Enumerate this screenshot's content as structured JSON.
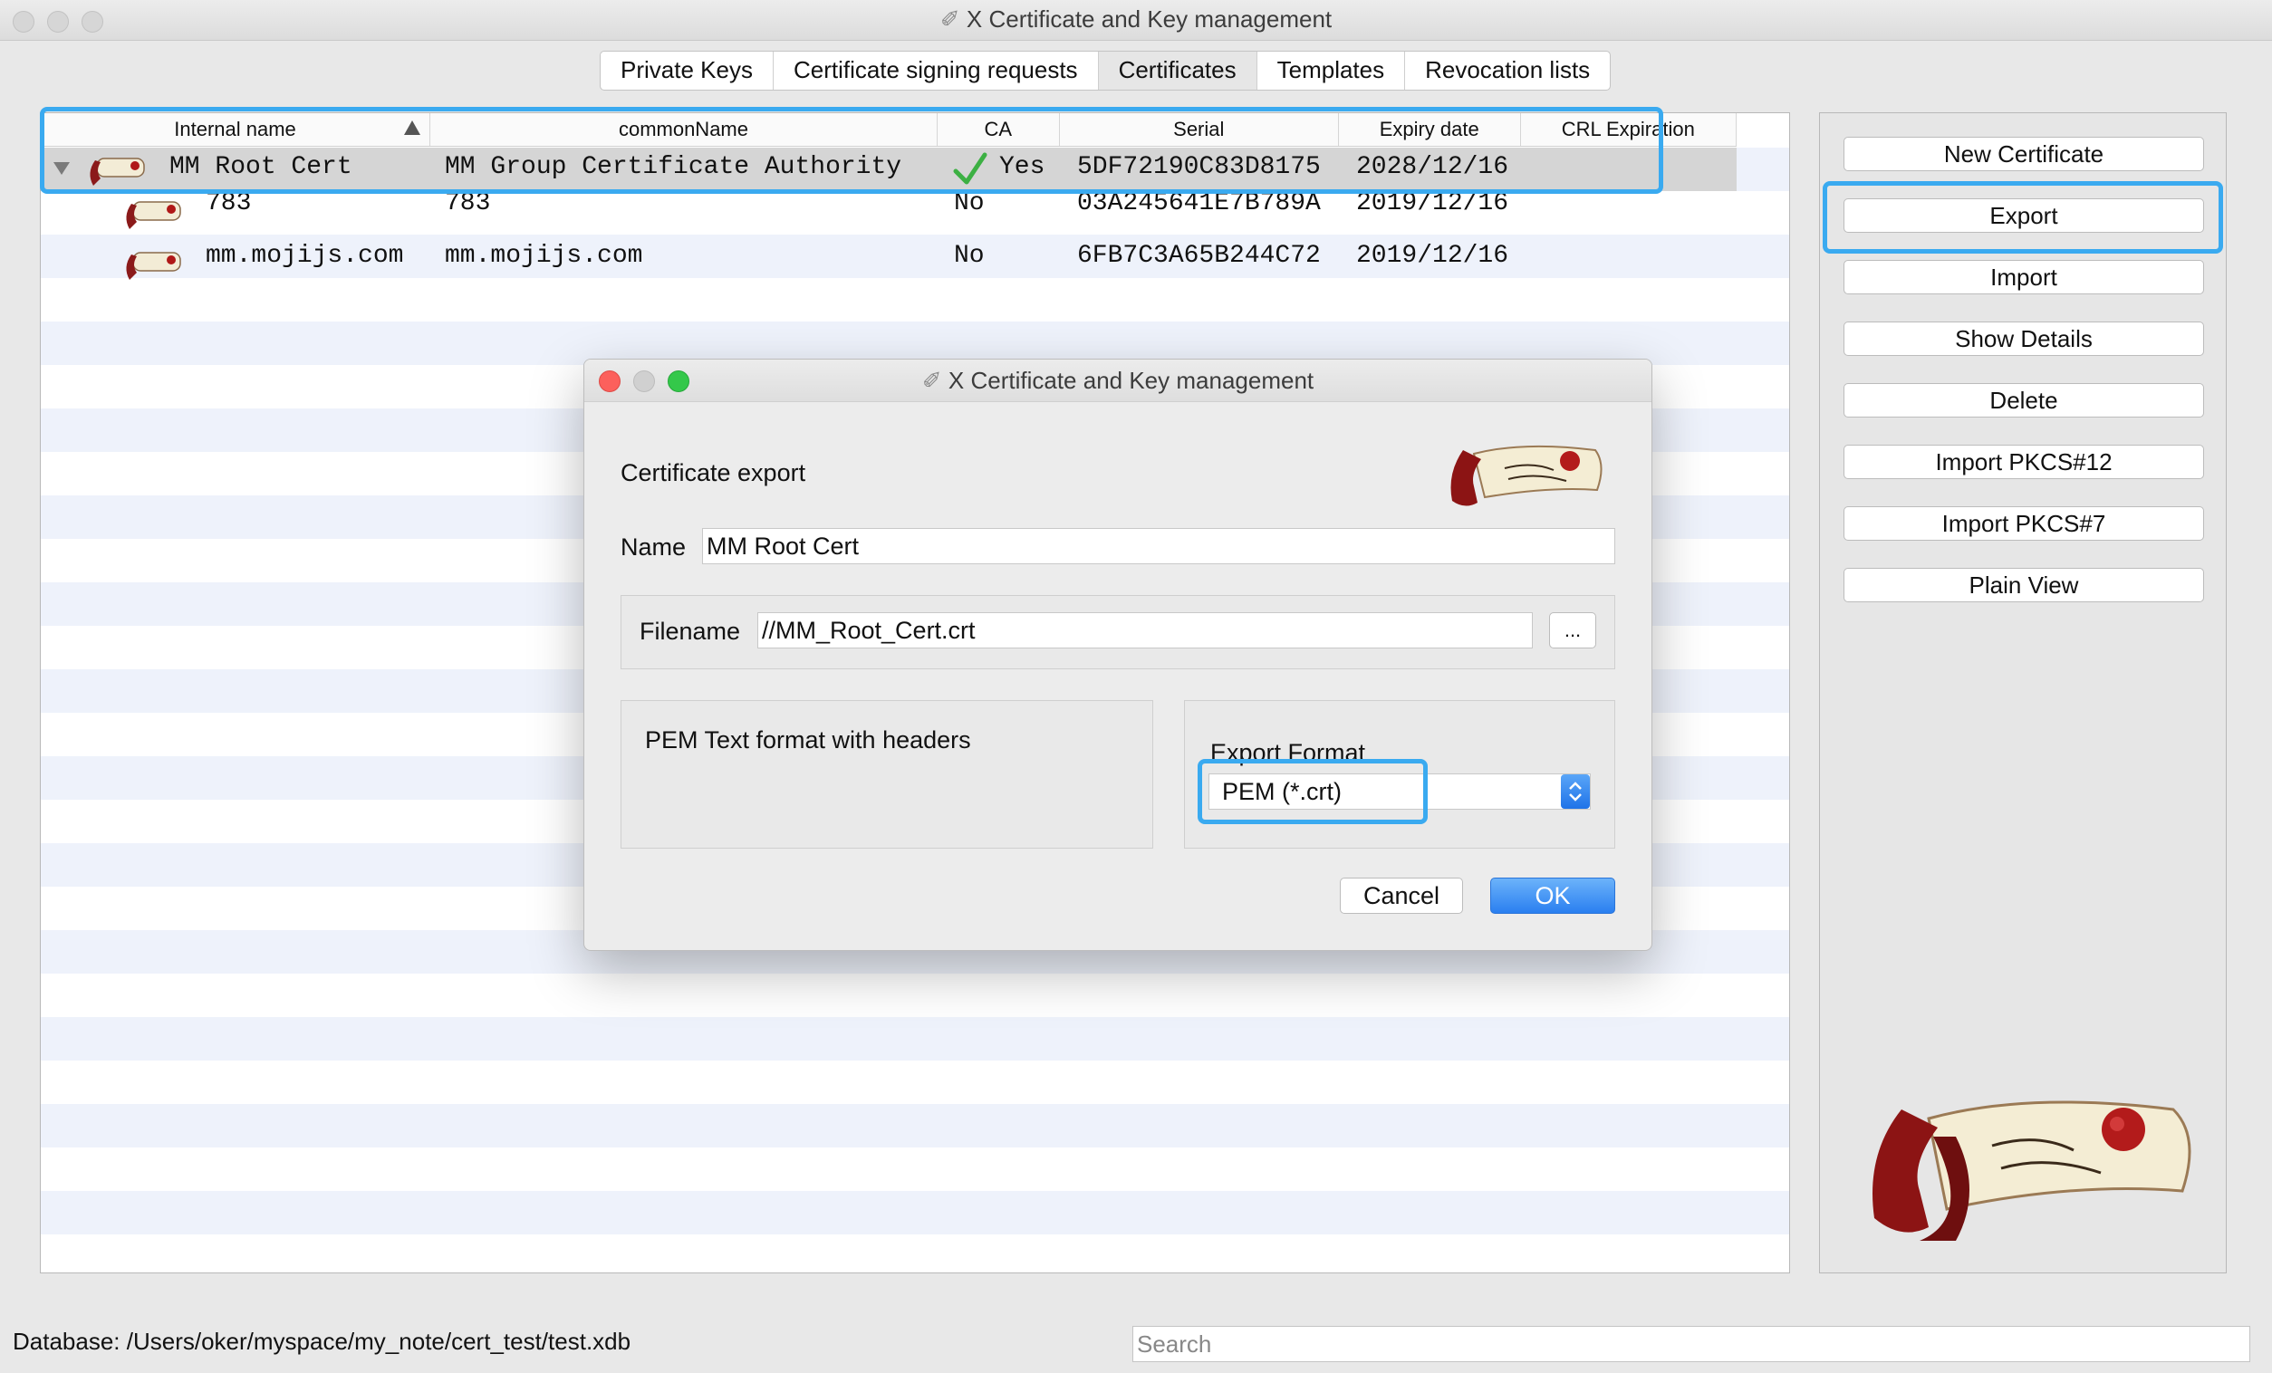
{
  "window": {
    "title": "X Certificate and Key management"
  },
  "tabs": [
    {
      "label": "Private Keys"
    },
    {
      "label": "Certificate signing requests"
    },
    {
      "label": "Certificates"
    },
    {
      "label": "Templates"
    },
    {
      "label": "Revocation lists"
    }
  ],
  "table": {
    "columns": [
      "Internal name",
      "commonName",
      "CA",
      "Serial",
      "Expiry date",
      "CRL Expiration"
    ],
    "rows": [
      {
        "internal_name": "MM Root Cert",
        "common_name": "MM Group Certificate Authority",
        "ca": "Yes",
        "serial": "5DF72190C83D8175",
        "expiry": "2028/12/16"
      },
      {
        "internal_name": "783",
        "common_name": "783",
        "ca": "No",
        "serial": "03A245641E7B789A",
        "expiry": "2019/12/16"
      },
      {
        "internal_name": "mm.mojijs.com",
        "common_name": "mm.mojijs.com",
        "ca": "No",
        "serial": "6FB7C3A65B244C72",
        "expiry": "2019/12/16"
      }
    ]
  },
  "side_buttons": [
    {
      "label": "New Certificate"
    },
    {
      "label": "Export"
    },
    {
      "label": "Import"
    },
    {
      "label": "Show Details"
    },
    {
      "label": "Delete"
    },
    {
      "label": "Import PKCS#12"
    },
    {
      "label": "Import PKCS#7"
    },
    {
      "label": "Plain View"
    }
  ],
  "status": {
    "database": "Database: /Users/oker/myspace/my_note/cert_test/test.xdb",
    "search_placeholder": "Search"
  },
  "dialog": {
    "title": "X Certificate and Key management",
    "heading": "Certificate export",
    "name_label": "Name",
    "name_value": "MM Root Cert",
    "filename_label": "Filename",
    "filename_value": "//MM_Root_Cert.crt",
    "browse_label": "...",
    "format_description": "PEM Text format with headers",
    "export_format_label": "Export Format",
    "export_format_value": "PEM (*.crt)",
    "cancel_label": "Cancel",
    "ok_label": "OK"
  },
  "colors": {
    "highlight": "#3aaaf0",
    "ok_button": "#2a7ff0",
    "row_stripe": "#eef2fb"
  }
}
